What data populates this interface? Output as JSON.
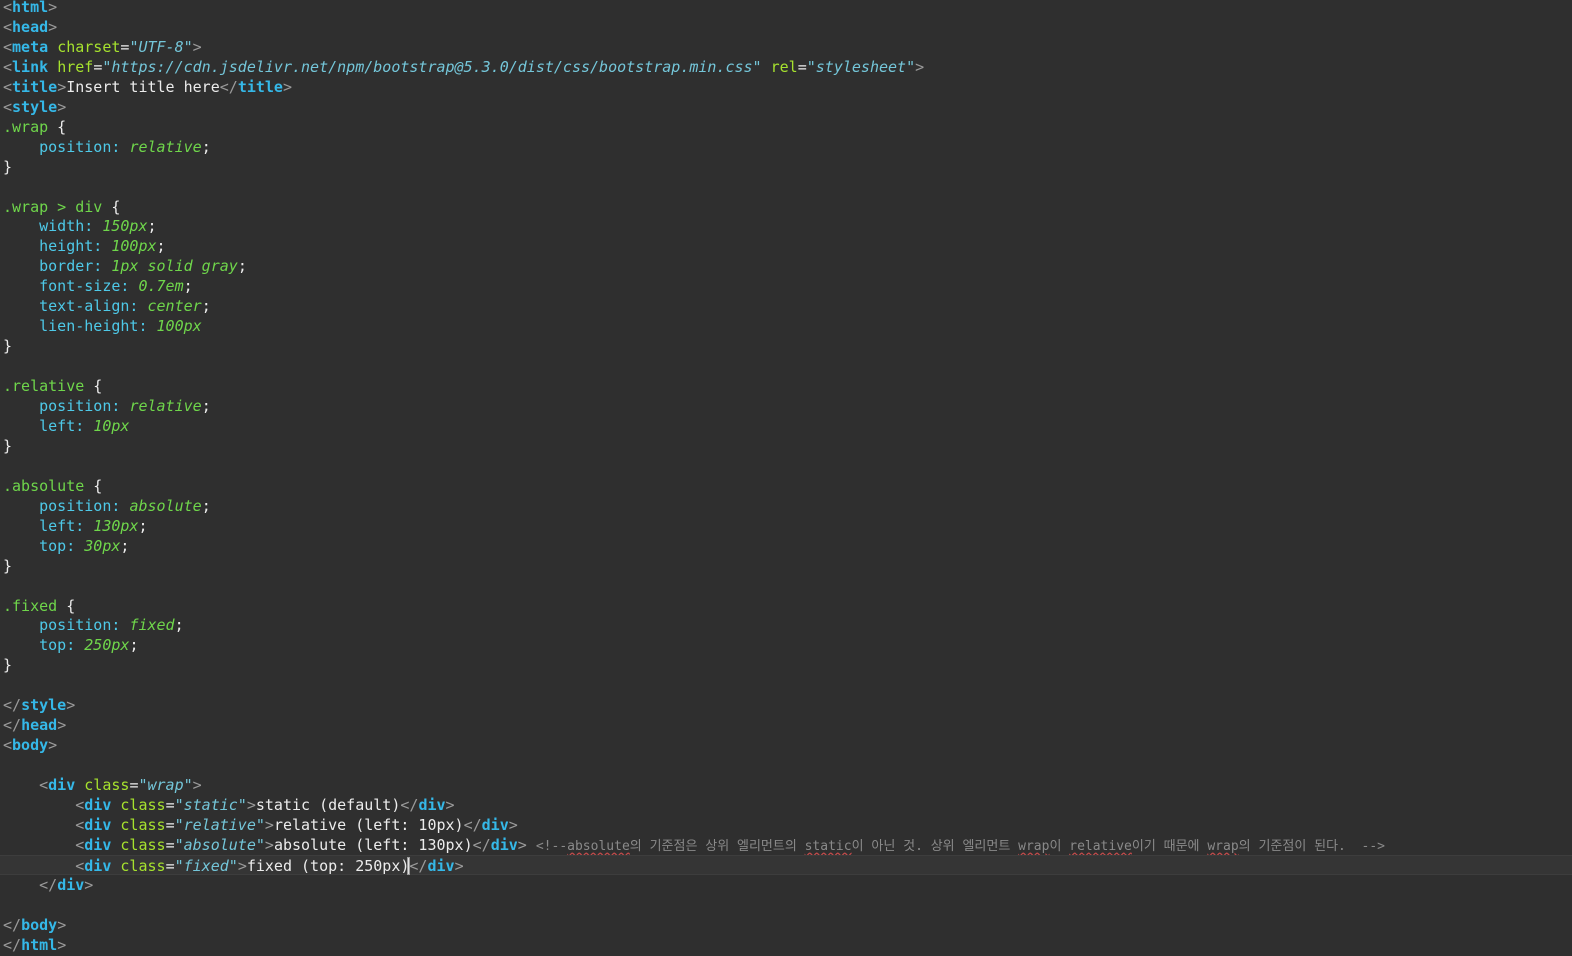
{
  "editor": {
    "lines": [
      [
        [
          "br",
          "<"
        ],
        [
          "tag",
          "html"
        ],
        [
          "br",
          ">"
        ]
      ],
      [
        [
          "br",
          "<"
        ],
        [
          "tag",
          "head"
        ],
        [
          "br",
          ">"
        ]
      ],
      [
        [
          "br",
          "<"
        ],
        [
          "tag",
          "meta"
        ],
        [
          "txt",
          " "
        ],
        [
          "attr",
          "charset"
        ],
        [
          "eq",
          "="
        ],
        [
          "str",
          "\"UTF-8\""
        ],
        [
          "br",
          ">"
        ]
      ],
      [
        [
          "br",
          "<"
        ],
        [
          "tag",
          "link"
        ],
        [
          "txt",
          " "
        ],
        [
          "attr",
          "href"
        ],
        [
          "eq",
          "="
        ],
        [
          "str",
          "\"https://cdn.jsdelivr.net/npm/bootstrap@5.3.0/dist/css/bootstrap.min.css\""
        ],
        [
          "txt",
          " "
        ],
        [
          "attr",
          "rel"
        ],
        [
          "eq",
          "="
        ],
        [
          "str",
          "\"stylesheet\""
        ],
        [
          "br",
          ">"
        ]
      ],
      [
        [
          "br",
          "<"
        ],
        [
          "tag",
          "title"
        ],
        [
          "br",
          ">"
        ],
        [
          "txt",
          "Insert title here"
        ],
        [
          "br",
          "</"
        ],
        [
          "tag",
          "title"
        ],
        [
          "br",
          ">"
        ]
      ],
      [
        [
          "br",
          "<"
        ],
        [
          "tag",
          "style"
        ],
        [
          "br",
          ">"
        ]
      ],
      [
        [
          "sel",
          ".wrap"
        ],
        [
          "pun",
          " {"
        ]
      ],
      [
        [
          "txt",
          "    "
        ],
        [
          "prop",
          "position:"
        ],
        [
          "txt",
          " "
        ],
        [
          "val",
          "relative"
        ],
        [
          "pun",
          ";"
        ]
      ],
      [
        [
          "pun",
          "}"
        ]
      ],
      [],
      [
        [
          "sel",
          ".wrap > div"
        ],
        [
          "pun",
          " {"
        ]
      ],
      [
        [
          "txt",
          "    "
        ],
        [
          "prop",
          "width:"
        ],
        [
          "txt",
          " "
        ],
        [
          "val",
          "150px"
        ],
        [
          "pun",
          ";"
        ]
      ],
      [
        [
          "txt",
          "    "
        ],
        [
          "prop",
          "height:"
        ],
        [
          "txt",
          " "
        ],
        [
          "val",
          "100px"
        ],
        [
          "pun",
          ";"
        ]
      ],
      [
        [
          "txt",
          "    "
        ],
        [
          "prop",
          "border:"
        ],
        [
          "txt",
          " "
        ],
        [
          "val",
          "1px solid gray"
        ],
        [
          "pun",
          ";"
        ]
      ],
      [
        [
          "txt",
          "    "
        ],
        [
          "prop",
          "font-size:"
        ],
        [
          "txt",
          " "
        ],
        [
          "val",
          "0.7em"
        ],
        [
          "pun",
          ";"
        ]
      ],
      [
        [
          "txt",
          "    "
        ],
        [
          "prop",
          "text-align:"
        ],
        [
          "txt",
          " "
        ],
        [
          "val",
          "center"
        ],
        [
          "pun",
          ";"
        ]
      ],
      [
        [
          "txt",
          "    "
        ],
        [
          "prop",
          "lien-height:"
        ],
        [
          "txt",
          " "
        ],
        [
          "val",
          "100px"
        ]
      ],
      [
        [
          "pun",
          "}"
        ]
      ],
      [],
      [
        [
          "sel",
          ".relative"
        ],
        [
          "pun",
          " {"
        ]
      ],
      [
        [
          "txt",
          "    "
        ],
        [
          "prop",
          "position:"
        ],
        [
          "txt",
          " "
        ],
        [
          "val",
          "relative"
        ],
        [
          "pun",
          ";"
        ]
      ],
      [
        [
          "txt",
          "    "
        ],
        [
          "prop",
          "left:"
        ],
        [
          "txt",
          " "
        ],
        [
          "val",
          "10px"
        ]
      ],
      [
        [
          "pun",
          "}"
        ]
      ],
      [],
      [
        [
          "sel",
          ".absolute"
        ],
        [
          "pun",
          " {"
        ]
      ],
      [
        [
          "txt",
          "    "
        ],
        [
          "prop",
          "position:"
        ],
        [
          "txt",
          " "
        ],
        [
          "val",
          "absolute"
        ],
        [
          "pun",
          ";"
        ]
      ],
      [
        [
          "txt",
          "    "
        ],
        [
          "prop",
          "left:"
        ],
        [
          "txt",
          " "
        ],
        [
          "val",
          "130px"
        ],
        [
          "pun",
          ";"
        ]
      ],
      [
        [
          "txt",
          "    "
        ],
        [
          "prop",
          "top:"
        ],
        [
          "txt",
          " "
        ],
        [
          "val",
          "30px"
        ],
        [
          "pun",
          ";"
        ]
      ],
      [
        [
          "pun",
          "}"
        ]
      ],
      [],
      [
        [
          "sel",
          ".fixed"
        ],
        [
          "pun",
          " {"
        ]
      ],
      [
        [
          "txt",
          "    "
        ],
        [
          "prop",
          "position:"
        ],
        [
          "txt",
          " "
        ],
        [
          "val",
          "fixed"
        ],
        [
          "pun",
          ";"
        ]
      ],
      [
        [
          "txt",
          "    "
        ],
        [
          "prop",
          "top:"
        ],
        [
          "txt",
          " "
        ],
        [
          "val",
          "250px"
        ],
        [
          "pun",
          ";"
        ]
      ],
      [
        [
          "pun",
          "}"
        ]
      ],
      [],
      [
        [
          "br",
          "</"
        ],
        [
          "tag",
          "style"
        ],
        [
          "br",
          ">"
        ]
      ],
      [
        [
          "br",
          "</"
        ],
        [
          "tag",
          "head"
        ],
        [
          "br",
          ">"
        ]
      ],
      [
        [
          "br",
          "<"
        ],
        [
          "tag",
          "body"
        ],
        [
          "br",
          ">"
        ]
      ],
      [],
      [
        [
          "txt",
          "    "
        ],
        [
          "br",
          "<"
        ],
        [
          "tag",
          "div"
        ],
        [
          "txt",
          " "
        ],
        [
          "attr",
          "class"
        ],
        [
          "eq",
          "="
        ],
        [
          "str",
          "\"wrap\""
        ],
        [
          "br",
          ">"
        ]
      ],
      [
        [
          "txt",
          "        "
        ],
        [
          "br",
          "<"
        ],
        [
          "tag",
          "div"
        ],
        [
          "txt",
          " "
        ],
        [
          "attr",
          "class"
        ],
        [
          "eq",
          "="
        ],
        [
          "str",
          "\"static\""
        ],
        [
          "br",
          ">"
        ],
        [
          "txt",
          "static (default)"
        ],
        [
          "br",
          "</"
        ],
        [
          "tag",
          "div"
        ],
        [
          "br",
          ">"
        ]
      ],
      [
        [
          "txt",
          "        "
        ],
        [
          "br",
          "<"
        ],
        [
          "tag",
          "div"
        ],
        [
          "txt",
          " "
        ],
        [
          "attr",
          "class"
        ],
        [
          "eq",
          "="
        ],
        [
          "str",
          "\"relative\""
        ],
        [
          "br",
          ">"
        ],
        [
          "txt",
          "relative (left: 10px)"
        ],
        [
          "br",
          "</"
        ],
        [
          "tag",
          "div"
        ],
        [
          "br",
          ">"
        ]
      ],
      [
        [
          "txt",
          "        "
        ],
        [
          "br",
          "<"
        ],
        [
          "tag",
          "div"
        ],
        [
          "txt",
          " "
        ],
        [
          "attr",
          "class"
        ],
        [
          "eq",
          "="
        ],
        [
          "str",
          "\"absolute\""
        ],
        [
          "br",
          ">"
        ],
        [
          "txt",
          "absolute (left: 130px)"
        ],
        [
          "br",
          "</"
        ],
        [
          "tag",
          "div"
        ],
        [
          "br",
          ">"
        ],
        [
          "txt",
          " "
        ],
        [
          "cm",
          "<!--"
        ],
        [
          "cm-u",
          "absolute"
        ],
        [
          "cm",
          "의 기준점은 상위 엘리먼트의 "
        ],
        [
          "cm-u",
          "static"
        ],
        [
          "cm",
          "이 아닌 것. 상위 엘리먼트 "
        ],
        [
          "cm-u",
          "wrap"
        ],
        [
          "cm",
          "이 "
        ],
        [
          "cm-u",
          "relative"
        ],
        [
          "cm",
          "이기 때문에 "
        ],
        [
          "cm-u",
          "wrap"
        ],
        [
          "cm",
          "의 기준점이 된다.  -->"
        ]
      ],
      [
        [
          "txt",
          "        "
        ],
        [
          "br",
          "<"
        ],
        [
          "tag",
          "div"
        ],
        [
          "txt",
          " "
        ],
        [
          "attr",
          "class"
        ],
        [
          "eq",
          "="
        ],
        [
          "str",
          "\"fixed\""
        ],
        [
          "br",
          ">"
        ],
        [
          "txt",
          "fixed (top: 250px)"
        ],
        [
          "caret",
          ""
        ],
        [
          "br",
          "</"
        ],
        [
          "tag",
          "div"
        ],
        [
          "br",
          ">"
        ]
      ],
      [
        [
          "txt",
          "    "
        ],
        [
          "br",
          "</"
        ],
        [
          "tag",
          "div"
        ],
        [
          "br",
          ">"
        ]
      ],
      [],
      [
        [
          "br",
          "</"
        ],
        [
          "tag",
          "body"
        ],
        [
          "br",
          ">"
        ]
      ],
      [
        [
          "br",
          "</"
        ],
        [
          "tag",
          "html"
        ],
        [
          "br",
          ">"
        ]
      ]
    ],
    "current_line": 43
  }
}
